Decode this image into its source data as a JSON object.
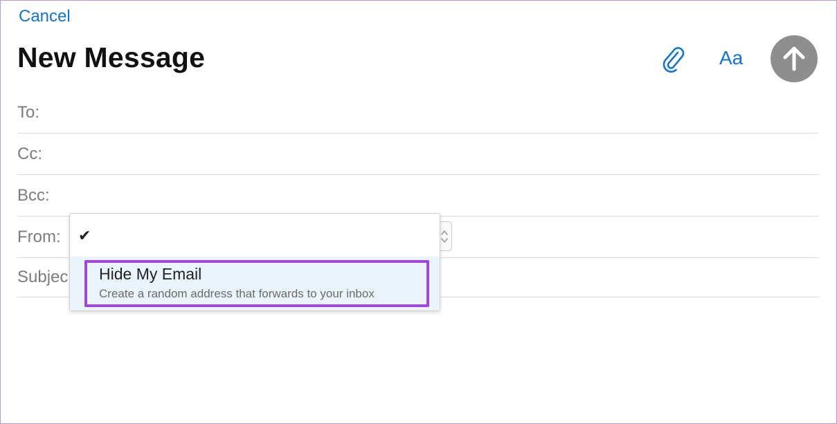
{
  "header": {
    "cancel_label": "Cancel",
    "title": "New Message",
    "format_label": "Aa",
    "attach_icon": "paperclip-icon",
    "send_icon": "arrow-up-icon"
  },
  "fields": {
    "to_label": "To:",
    "cc_label": "Cc:",
    "bcc_label": "Bcc:",
    "from_label": "From:",
    "subject_label": "Subjec"
  },
  "from_dropdown": {
    "selected_check": "✔",
    "option": {
      "title": "Hide My Email",
      "description": "Create a random address that forwards to your inbox"
    }
  },
  "colors": {
    "accent": "#1273d1",
    "send_disabled": "#8e8e8e",
    "highlight": "#a046e0",
    "option_bg": "#e9f4fc"
  }
}
